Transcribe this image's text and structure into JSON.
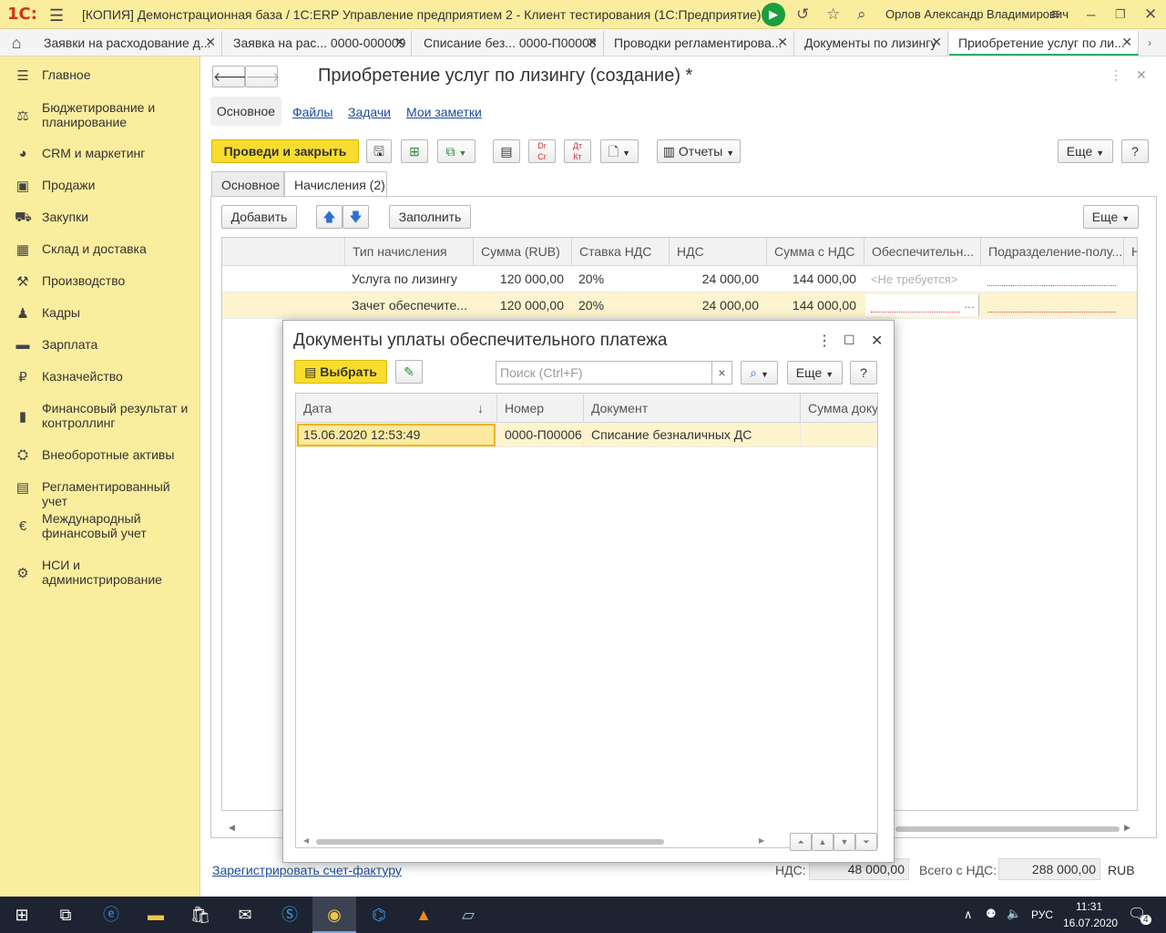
{
  "window": {
    "logo": "1С:",
    "title": "[КОПИЯ] Демонстрационная база / 1С:ERP Управление предприятием 2  - Клиент тестирования (1С:Предприятие)",
    "user": "Орлов Александр Владимирович"
  },
  "tabs": [
    {
      "label": "Заявки на расходование д..."
    },
    {
      "label": "Заявка на рас... 0000-000009"
    },
    {
      "label": "Списание без... 0000-П00008"
    },
    {
      "label": "Проводки регламентирова..."
    },
    {
      "label": "Документы по лизингу"
    },
    {
      "label": "Приобретение услуг по ли..."
    }
  ],
  "sidebar": {
    "items": [
      {
        "label": "Главное",
        "icon": "menu-lines-icon"
      },
      {
        "label": "Бюджетирование и планирование",
        "icon": "budget-icon"
      },
      {
        "label": "CRM и маркетинг",
        "icon": "crm-icon"
      },
      {
        "label": "Продажи",
        "icon": "sales-bag-icon"
      },
      {
        "label": "Закупки",
        "icon": "cart-icon"
      },
      {
        "label": "Склад и доставка",
        "icon": "warehouse-icon"
      },
      {
        "label": "Производство",
        "icon": "factory-icon"
      },
      {
        "label": "Кадры",
        "icon": "person-icon"
      },
      {
        "label": "Зарплата",
        "icon": "salary-icon"
      },
      {
        "label": "Казначейство",
        "icon": "ruble-icon"
      },
      {
        "label": "Финансовый результат и контроллинг",
        "icon": "chart-icon"
      },
      {
        "label": "Внеоборотные активы",
        "icon": "assets-icon"
      },
      {
        "label": "Регламентированный учет",
        "icon": "accounting-icon"
      },
      {
        "label": "Международный финансовый учет",
        "icon": "euro-icon"
      },
      {
        "label": "НСИ и администрирование",
        "icon": "gear-icon"
      }
    ]
  },
  "form": {
    "title": "Приобретение услуг по лизингу (создание) *",
    "nav": {
      "main": "Основное",
      "files": "Файлы",
      "tasks": "Задачи",
      "notes": "Мои заметки"
    },
    "toolbar": {
      "post_close": "Проведи и закрыть",
      "reports": "Отчеты",
      "more": "Еще",
      "help": "?"
    },
    "inner_tabs": {
      "main": "Основное",
      "charges": "Начисления (2)"
    },
    "charges_toolbar": {
      "add": "Добавить",
      "fill": "Заполнить",
      "more": "Еще"
    },
    "grid": {
      "headers": [
        "Тип начисления",
        "Сумма (RUB)",
        "Ставка НДС",
        "НДС",
        "Сумма с НДС",
        "Обеспечительн...",
        "Подразделение-полу...",
        "Н"
      ],
      "rows": [
        {
          "type": "Услуга по лизингу",
          "sum": "120 000,00",
          "rate": "20%",
          "vat": "24 000,00",
          "total": "144 000,00",
          "security": "<Не требуется>"
        },
        {
          "type": "Зачет обеспечите...",
          "sum": "120 000,00",
          "rate": "20%",
          "vat": "24 000,00",
          "total": "144 000,00",
          "security": ""
        }
      ]
    },
    "footer": {
      "register_link": "Зарегистрировать счет-фактуру",
      "vat_label": "НДС:",
      "vat_value": "48 000,00",
      "total_label": "Всего с НДС:",
      "total_value": "288 000,00",
      "currency": "RUB"
    }
  },
  "dialog": {
    "title": "Документы уплаты обеспечительного платежа",
    "select": "Выбрать",
    "search_placeholder": "Поиск (Ctrl+F)",
    "more": "Еще",
    "help": "?",
    "headers": [
      "Дата",
      "Номер",
      "Документ",
      "Сумма доку"
    ],
    "rows": [
      {
        "date": "15.06.2020 12:53:49",
        "number": "0000-П00006",
        "document": "Списание безналичных ДС"
      }
    ]
  },
  "taskbar": {
    "lang": "РУС",
    "time": "11:31",
    "date": "16.07.2020",
    "notifications": "4"
  },
  "colors": {
    "sidebar_bg": "#fbed9e",
    "accent_yellow": "#f8dd2e",
    "link_blue": "#1d4c9c",
    "selected_row": "#fdf4cf",
    "active_tab_underline": "#2dae5f"
  }
}
